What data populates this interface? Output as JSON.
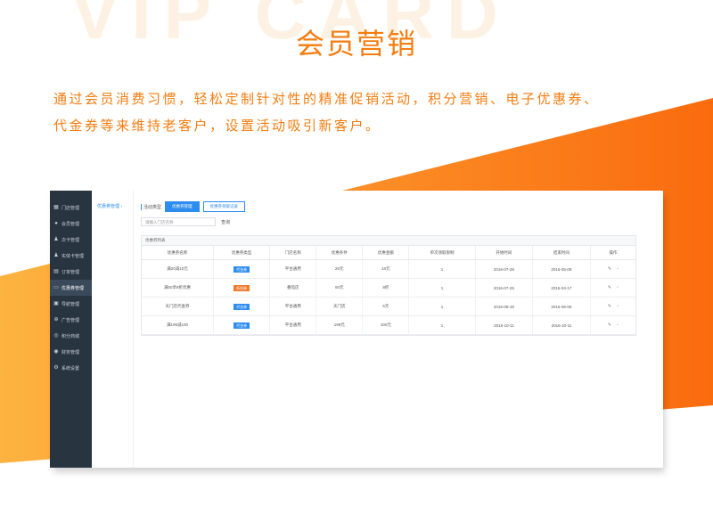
{
  "hero": {
    "watermark": "VIP CARD",
    "title": "会员营销",
    "description_line1": "通过会员消费习惯，轻松定制针对性的精准促销活动，积分营销、电子优惠券、",
    "description_line2": "代金券等来维持老客户，设置活动吸引新客户。"
  },
  "colors": {
    "brand_orange": "#f47d10",
    "sidebar_bg": "#293441",
    "accent_blue": "#2d8cf0",
    "badge_orange": "#f07a2e"
  },
  "sidebar": {
    "items": [
      {
        "label": "门店管理",
        "icon": "store-icon"
      },
      {
        "label": "会员管理",
        "icon": "members-icon"
      },
      {
        "label": "次卡管理",
        "icon": "user-card-icon"
      },
      {
        "label": "实体卡管理",
        "icon": "card-icon"
      },
      {
        "label": "订单管理",
        "icon": "order-icon"
      },
      {
        "label": "优惠券管理",
        "icon": "coupon-icon",
        "active": true
      },
      {
        "label": "导航管理",
        "icon": "nav-icon"
      },
      {
        "label": "广告管理",
        "icon": "ad-icon"
      },
      {
        "label": "积分商城",
        "icon": "points-icon"
      },
      {
        "label": "财务管理",
        "icon": "finance-icon"
      },
      {
        "label": "系统设置",
        "icon": "settings-icon"
      }
    ]
  },
  "subnav": {
    "item": "优惠券管理 ›"
  },
  "tabs": {
    "label": "活动类型",
    "items": [
      "优惠券管理",
      "优惠券领取记录"
    ]
  },
  "search": {
    "placeholder": "请输入门店名称",
    "button": "查询"
  },
  "panel": {
    "title": "优惠券列表"
  },
  "table": {
    "headers": [
      "优惠券名称",
      "优惠券类型",
      "门店名称",
      "优惠条件",
      "优惠金额",
      "单次领取限制",
      "开始时间",
      "结束时间",
      "操作"
    ],
    "rows": [
      {
        "name": "满20减10元",
        "type": "代金券",
        "badge": "blue",
        "store": "平台通用",
        "condition": "20元",
        "amount": "10元",
        "limit": "1",
        "start": "2016-07-28",
        "end": "2016-05-09"
      },
      {
        "name": "满50享8折优惠",
        "type": "折扣券",
        "badge": "orange",
        "store": "番茄店",
        "condition": "50元",
        "amount": "8折",
        "limit": "1",
        "start": "2016-07-25",
        "end": "2016-04-17"
      },
      {
        "name": "天门店代金券",
        "type": "代金券",
        "badge": "blue",
        "store": "平台通用",
        "condition": "天门店",
        "amount": "5元",
        "limit": "1",
        "start": "2016-09-18",
        "end": "2016-06-06"
      },
      {
        "name": "满199减100",
        "type": "代金券",
        "badge": "blue",
        "store": "平台通用",
        "condition": "199元",
        "amount": "100元",
        "limit": "1",
        "start": "2016-10-11",
        "end": "2016-10-11"
      }
    ]
  }
}
